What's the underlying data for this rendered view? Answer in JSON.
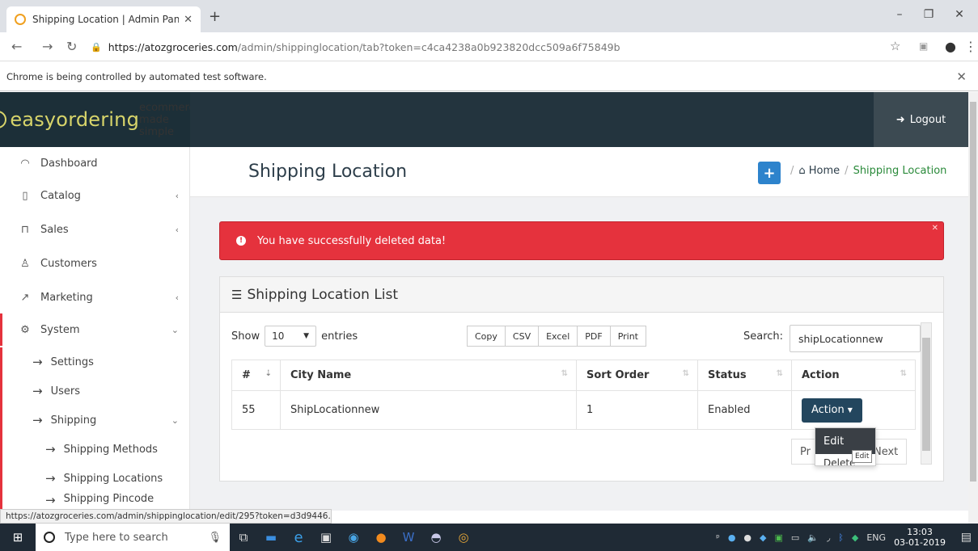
{
  "browser": {
    "tab_title": "Shipping Location | Admin Panel",
    "url_domain": "https://atozgroceries.com",
    "url_path": "/admin/shippinglocation/tab?token=c4ca4238a0b923820dcc509a6f75849b",
    "infobar_text": "Chrome is being controlled by automated test software.",
    "status_url": "https://atozgroceries.com/admin/shippinglocation/edit/295?token=d3d9446..."
  },
  "header": {
    "logo_text": "easyordering",
    "logo_tagline": "ecommerce made simple",
    "logout_label": "Logout"
  },
  "sidebar": {
    "items": [
      {
        "label": "Dashboard"
      },
      {
        "label": "Catalog"
      },
      {
        "label": "Sales"
      },
      {
        "label": "Customers"
      },
      {
        "label": "Marketing"
      },
      {
        "label": "System"
      }
    ],
    "system_sub": [
      {
        "label": "Settings"
      },
      {
        "label": "Users"
      },
      {
        "label": "Shipping"
      }
    ],
    "shipping_sub": [
      {
        "label": "Shipping Methods"
      },
      {
        "label": "Shipping Locations"
      },
      {
        "label": "Shipping Pincode"
      }
    ]
  },
  "page": {
    "title": "Shipping Location",
    "breadcrumb_home": "Home",
    "breadcrumb_current": "Shipping Location",
    "alert": "You have successfully deleted data!",
    "panel_title": "Shipping Location List"
  },
  "table_controls": {
    "show_label": "Show",
    "entries_value": "10",
    "entries_label": "entries",
    "export_buttons": [
      "Copy",
      "CSV",
      "Excel",
      "PDF",
      "Print"
    ],
    "search_label": "Search:",
    "search_value": "shipLocationnew"
  },
  "table": {
    "headers": [
      "#",
      "City Name",
      "Sort Order",
      "Status",
      "Action"
    ],
    "rows": [
      {
        "id": "55",
        "city": "ShipLocationnew",
        "sort_order": "1",
        "status": "Enabled",
        "action": "Action"
      }
    ]
  },
  "dropdown": {
    "edit": "Edit",
    "delete": "Delete",
    "tooltip": "Edit"
  },
  "pagination": {
    "prev": "Pr",
    "next": "Next"
  },
  "taskbar": {
    "search_placeholder": "Type here to search",
    "language": "ENG",
    "time": "13:03",
    "date": "03-01-2019"
  }
}
